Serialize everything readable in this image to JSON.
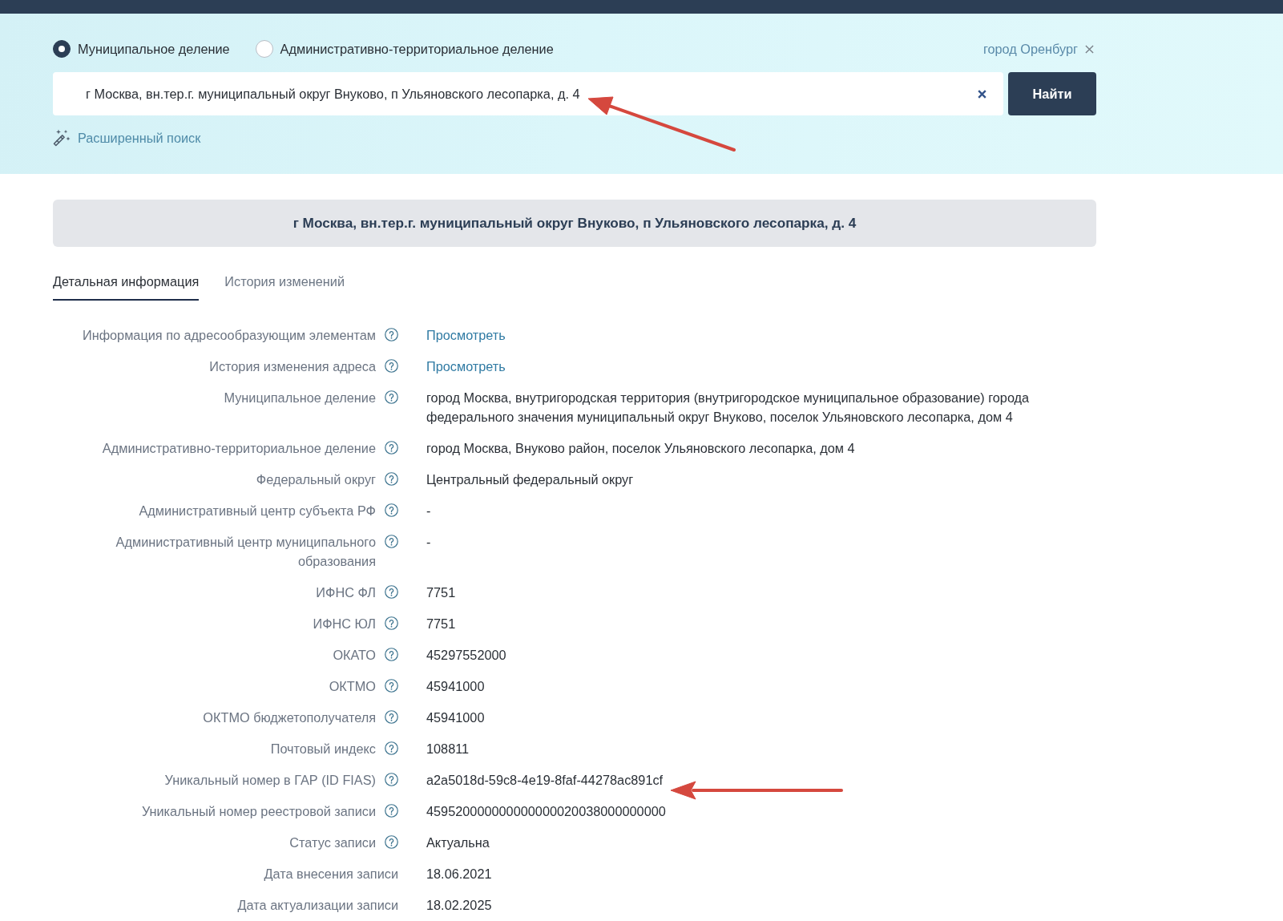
{
  "search": {
    "division_options": [
      {
        "label": "Муниципальное деление",
        "selected": true
      },
      {
        "label": "Административно-территориальное деление",
        "selected": false
      }
    ],
    "region_filter": {
      "label": "город Оренбург"
    },
    "query": {
      "value": "г Москва, вн.тер.г. муниципальный округ Внуково, п Ульяновского лесопарка, д. 4"
    },
    "submit_button": "Найти",
    "advanced_search_link": "Расширенный поиск"
  },
  "address_title": "г Москва, вн.тер.г. муниципальный округ Внуково, п Ульяновского лесопарка, д. 4",
  "tabs": [
    {
      "label": "Детальная информация",
      "selected": true
    },
    {
      "label": "История изменений",
      "selected": false
    }
  ],
  "details": [
    {
      "label": "Информация по адресообразующим элементам",
      "help": true,
      "kind": "link",
      "value": "Просмотреть"
    },
    {
      "label": "История изменения адреса",
      "help": true,
      "kind": "link",
      "value": "Просмотреть"
    },
    {
      "label": "Муниципальное деление",
      "help": true,
      "kind": "text",
      "value": "город Москва, внутригородская территория (внутригородское муниципальное образование) города федерального значения муниципальный округ Внуково, поселок Ульяновского лесопарка, дом 4"
    },
    {
      "label": "Административно-территориальное деление",
      "help": true,
      "kind": "text",
      "value": "город Москва, Внуково район, поселок Ульяновского лесопарка, дом 4"
    },
    {
      "label": "Федеральный округ",
      "help": true,
      "kind": "text",
      "value": "Центральный федеральный округ"
    },
    {
      "label": "Административный центр субъекта РФ",
      "help": true,
      "kind": "text",
      "value": "-"
    },
    {
      "label": "Административный центр муниципального образования",
      "help": true,
      "kind": "text",
      "value": "-"
    },
    {
      "label": "ИФНС ФЛ",
      "help": true,
      "kind": "text",
      "value": "7751"
    },
    {
      "label": "ИФНС ЮЛ",
      "help": true,
      "kind": "text",
      "value": "7751"
    },
    {
      "label": "ОКАТО",
      "help": true,
      "kind": "text",
      "value": "45297552000"
    },
    {
      "label": "ОКТМО",
      "help": true,
      "kind": "text",
      "value": "45941000"
    },
    {
      "label": "ОКТМО бюджетополучателя",
      "help": true,
      "kind": "text",
      "value": "45941000"
    },
    {
      "label": "Почтовый индекс",
      "help": true,
      "kind": "text",
      "value": "108811"
    },
    {
      "label": "Уникальный номер в ГАР (ID FIAS)",
      "help": true,
      "kind": "text",
      "value": "a2a5018d-59c8-4e19-8faf-44278ac891cf"
    },
    {
      "label": "Уникальный номер реестровой записи",
      "help": true,
      "kind": "text",
      "value": "459520000000000000020038000000000"
    },
    {
      "label": "Статус записи",
      "help": true,
      "kind": "text",
      "value": "Актуальна"
    },
    {
      "label": "Дата внесения записи",
      "help": false,
      "kind": "text",
      "value": "18.06.2021"
    },
    {
      "label": "Дата актуализации записи",
      "help": false,
      "kind": "text",
      "value": "18.02.2025"
    }
  ]
}
